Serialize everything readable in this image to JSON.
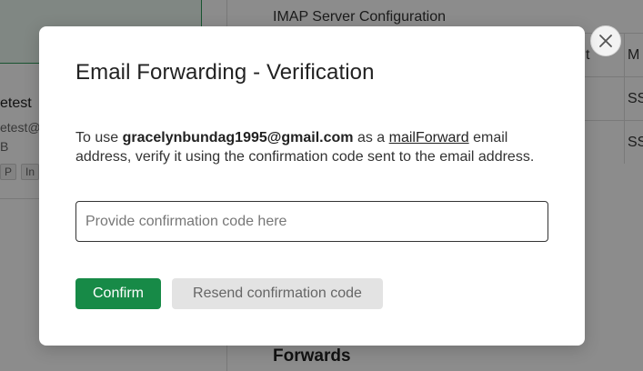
{
  "background": {
    "account": {
      "name": "etest",
      "email": "etest@",
      "size": "B",
      "tags": [
        "P",
        "In"
      ]
    },
    "imap_title": "IMAP Server Configuration",
    "table": {
      "header": [
        "t",
        "M"
      ],
      "rows": [
        [
          "",
          "SS"
        ],
        [
          "",
          "SS"
        ]
      ]
    },
    "forwards_title": "Forwards"
  },
  "modal": {
    "title": "Email Forwarding - Verification",
    "description": {
      "prefix": "To use ",
      "email": "gracelynbundag1995@gmail.com",
      "middle": " as a ",
      "link": "mailForward",
      "suffix": " email address, verify it using the confirmation code sent to the email address."
    },
    "input": {
      "value": "",
      "placeholder": "Provide confirmation code here"
    },
    "confirm_label": "Confirm",
    "resend_label": "Resend confirmation code",
    "close_icon": "close-icon"
  },
  "colors": {
    "primary_green": "#178a47",
    "overlay": "rgba(0,0,0,0.45)",
    "secondary_button": "#e3e3e3"
  }
}
